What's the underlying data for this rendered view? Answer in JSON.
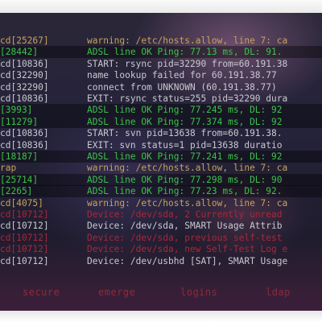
{
  "log": {
    "rows": [
      {
        "pid": "cd[25267]",
        "msg": "warning: /etc/hosts.allow, line 7: ca",
        "pid_color": "#c8a25c",
        "msg_color": "#c8a25c"
      },
      {
        "pid": "[28442]",
        "msg": "ADSL line OK Ping: 77.13 ms, DL: 91.",
        "pid_color": "#3cc24a",
        "msg_color": "#3cc24a"
      },
      {
        "pid": "cd[10836]",
        "msg": "START: rsync pid=32290 from=60.191.38",
        "pid_color": "#c9c9d0",
        "msg_color": "#c9c9d0"
      },
      {
        "pid": "cd[32290]",
        "msg": "name lookup failed for 60.191.38.77",
        "pid_color": "#c9c9d0",
        "msg_color": "#c9c9d0"
      },
      {
        "pid": "cd[32290]",
        "msg": "connect from UNKNOWN (60.191.38.77)",
        "pid_color": "#c9c9d0",
        "msg_color": "#c9c9d0"
      },
      {
        "pid": "cd[10836]",
        "msg": "EXIT: rsync status=255 pid=32290 dura",
        "pid_color": "#c9c9d0",
        "msg_color": "#c9c9d0"
      },
      {
        "pid": "[3993]",
        "msg": "ADSL line OK Ping: 77.245 ms, DL: 92",
        "pid_color": "#3cc24a",
        "msg_color": "#3cc24a"
      },
      {
        "pid": "[11279]",
        "msg": "ADSL line OK Ping: 77.374 ms, DL: 92",
        "pid_color": "#3cc24a",
        "msg_color": "#3cc24a"
      },
      {
        "pid": "cd[10836]",
        "msg": "START: svn pid=13638 from=60.191.38.",
        "pid_color": "#c9c9d0",
        "msg_color": "#c9c9d0"
      },
      {
        "pid": "cd[10836]",
        "msg": "EXIT: svn status=1 pid=13638 duratio",
        "pid_color": "#c9c9d0",
        "msg_color": "#c9c9d0"
      },
      {
        "pid": "[18187]",
        "msg": "ADSL line OK Ping: 77.241 ms, DL: 92",
        "pid_color": "#3cc24a",
        "msg_color": "#3cc24a"
      },
      {
        "pid": "rap",
        "msg": "warning: /etc/hosts.allow, line 7: ca",
        "pid_color": "#c8a25c",
        "msg_color": "#c8a25c"
      },
      {
        "pid": "[25714]",
        "msg": "ADSL line OK Ping: 77.298 ms, DL: 90",
        "pid_color": "#3cc24a",
        "msg_color": "#3cc24a"
      },
      {
        "pid": "[2265]",
        "msg": "ADSL line OK Ping: 77.23 ms, DL: 92.",
        "pid_color": "#3cc24a",
        "msg_color": "#3cc24a"
      },
      {
        "pid": "cd[4075]",
        "msg": "warning: /etc/hosts.allow, line 7: ca",
        "pid_color": "#c8a25c",
        "msg_color": "#c8a25c"
      },
      {
        "pid": "cd[10712]",
        "msg": "Device: /dev/sda, 2 Currently unread",
        "pid_color": "#a8283a",
        "msg_color": "#a8283a"
      },
      {
        "pid": "cd[10712]",
        "msg": "Device: /dev/sda, SMART Usage Attrib",
        "pid_color": "#c9c9d0",
        "msg_color": "#c9c9d0"
      },
      {
        "pid": "cd[10712]",
        "msg": "Device: /dev/sda, previous self-test",
        "pid_color": "#a8283a",
        "msg_color": "#a8283a"
      },
      {
        "pid": "cd[10712]",
        "msg": "Device: /dev/sda, new Self-Test Log e",
        "pid_color": "#a8283a",
        "msg_color": "#a8283a"
      },
      {
        "pid": "cd[10712]",
        "msg": "Device: /dev/usbhd [SAT], SMART Usage",
        "pid_color": "#c9c9d0",
        "msg_color": "#c9c9d0"
      }
    ],
    "highlighted_rows": [
      1,
      6,
      7,
      10,
      12,
      13
    ]
  },
  "tabs": [
    {
      "label": "secure"
    },
    {
      "label": "emerge"
    },
    {
      "label": "logins"
    },
    {
      "label": "ldap"
    }
  ]
}
